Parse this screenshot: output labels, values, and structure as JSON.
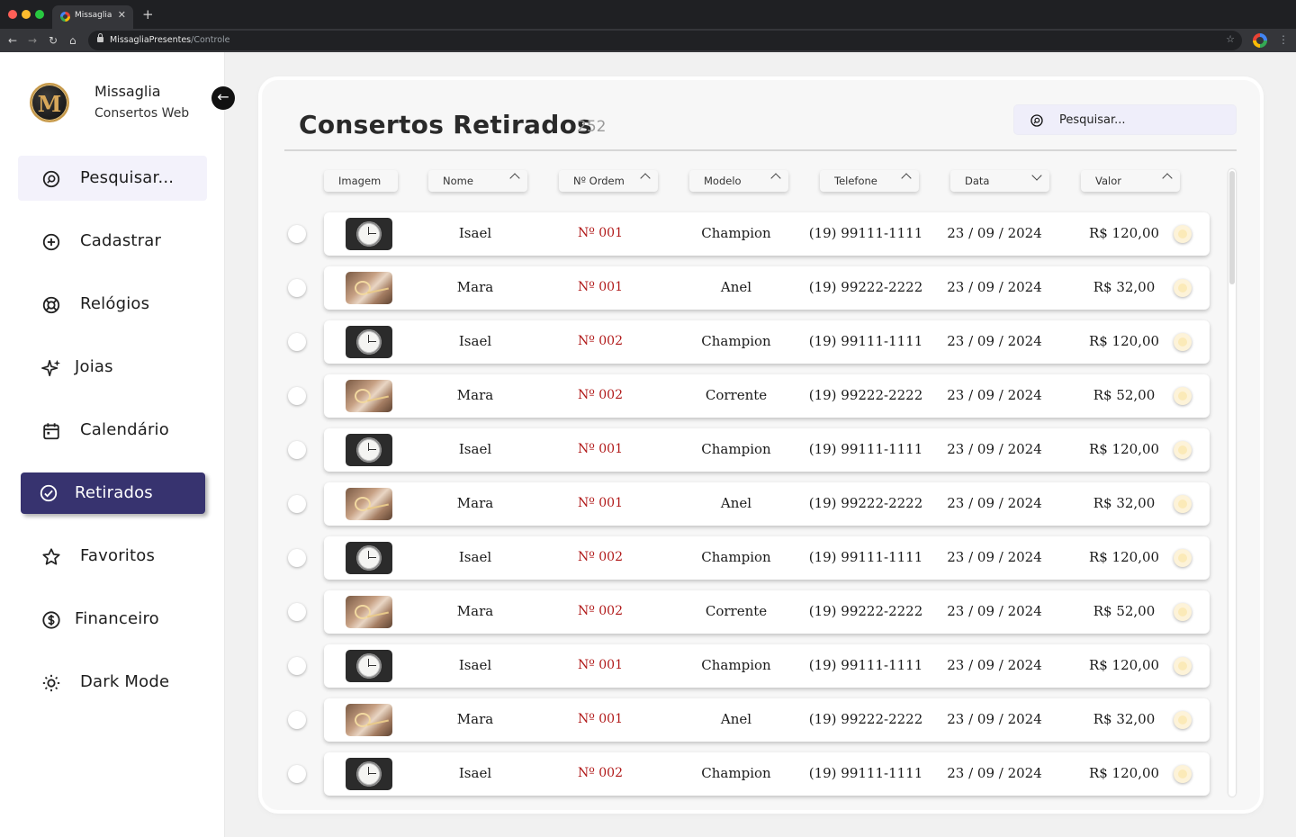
{
  "browser": {
    "tab_title": "Missaglia",
    "url_host": "MissagliaPresentes",
    "url_path": "/Controle",
    "traffic_colors": [
      "#ff5f57",
      "#febc2e",
      "#28c840"
    ]
  },
  "brand": {
    "logo_letter": "M",
    "name": "Missaglia",
    "subtitle": "Consertos Web"
  },
  "sidebar": {
    "items": [
      {
        "label": "Pesquisar...",
        "icon": "search-icon",
        "state": "hover"
      },
      {
        "label": "Cadastrar",
        "icon": "plus-circle-icon",
        "state": ""
      },
      {
        "label": "Relógios",
        "icon": "watch-icon",
        "state": ""
      },
      {
        "label": "Joias",
        "icon": "sparkles-icon",
        "state": ""
      },
      {
        "label": "Calendário",
        "icon": "calendar-icon",
        "state": ""
      },
      {
        "label": "Retirados",
        "icon": "check-circle-icon",
        "state": "active"
      },
      {
        "label": "Favoritos",
        "icon": "star-icon",
        "state": ""
      },
      {
        "label": "Financeiro",
        "icon": "dollar-circle-icon",
        "state": ""
      },
      {
        "label": "Dark Mode",
        "icon": "sun-icon",
        "state": ""
      }
    ]
  },
  "main": {
    "title": "Consertos Retirados",
    "count": "252",
    "search_placeholder": "Pesquisar...",
    "columns": [
      {
        "label": "Imagem",
        "sort": "none"
      },
      {
        "label": "Nome",
        "sort": "up"
      },
      {
        "label": "Nº Ordem",
        "sort": "up"
      },
      {
        "label": "Modelo",
        "sort": "up"
      },
      {
        "label": "Telefone",
        "sort": "up"
      },
      {
        "label": "Data",
        "sort": "down"
      },
      {
        "label": "Valor",
        "sort": "up"
      }
    ],
    "rows": [
      {
        "image": "watch",
        "nome": "Isael",
        "ordem": "Nº 001",
        "modelo": "Champion",
        "telefone": "(19) 99111-1111",
        "data": "23 / 09 / 2024",
        "valor": "R$ 120,00"
      },
      {
        "image": "jewel",
        "nome": "Mara",
        "ordem": "Nº 001",
        "modelo": "Anel",
        "telefone": "(19) 99222-2222",
        "data": "23 / 09 / 2024",
        "valor": "R$ 32,00"
      },
      {
        "image": "watch",
        "nome": "Isael",
        "ordem": "Nº 002",
        "modelo": "Champion",
        "telefone": "(19) 99111-1111",
        "data": "23 / 09 / 2024",
        "valor": "R$ 120,00"
      },
      {
        "image": "jewel",
        "nome": "Mara",
        "ordem": "Nº 002",
        "modelo": "Corrente",
        "telefone": "(19) 99222-2222",
        "data": "23 / 09 / 2024",
        "valor": "R$ 52,00"
      },
      {
        "image": "watch",
        "nome": "Isael",
        "ordem": "Nº 001",
        "modelo": "Champion",
        "telefone": "(19) 99111-1111",
        "data": "23 / 09 / 2024",
        "valor": "R$ 120,00"
      },
      {
        "image": "jewel",
        "nome": "Mara",
        "ordem": "Nº 001",
        "modelo": "Anel",
        "telefone": "(19) 99222-2222",
        "data": "23 / 09 / 2024",
        "valor": "R$ 32,00"
      },
      {
        "image": "watch",
        "nome": "Isael",
        "ordem": "Nº 002",
        "modelo": "Champion",
        "telefone": "(19) 99111-1111",
        "data": "23 / 09 / 2024",
        "valor": "R$ 120,00"
      },
      {
        "image": "jewel",
        "nome": "Mara",
        "ordem": "Nº 002",
        "modelo": "Corrente",
        "telefone": "(19) 99222-2222",
        "data": "23 / 09 / 2024",
        "valor": "R$ 52,00"
      },
      {
        "image": "watch",
        "nome": "Isael",
        "ordem": "Nº 001",
        "modelo": "Champion",
        "telefone": "(19) 99111-1111",
        "data": "23 / 09 / 2024",
        "valor": "R$ 120,00"
      },
      {
        "image": "jewel",
        "nome": "Mara",
        "ordem": "Nº 001",
        "modelo": "Anel",
        "telefone": "(19) 99222-2222",
        "data": "23 / 09 / 2024",
        "valor": "R$ 32,00"
      },
      {
        "image": "watch",
        "nome": "Isael",
        "ordem": "Nº 002",
        "modelo": "Champion",
        "telefone": "(19) 99111-1111",
        "data": "23 / 09 / 2024",
        "valor": "R$ 120,00"
      }
    ]
  },
  "colors": {
    "accent": "#37336f",
    "ordem_red": "#b11a1a",
    "search_bg": "#efeefa"
  }
}
